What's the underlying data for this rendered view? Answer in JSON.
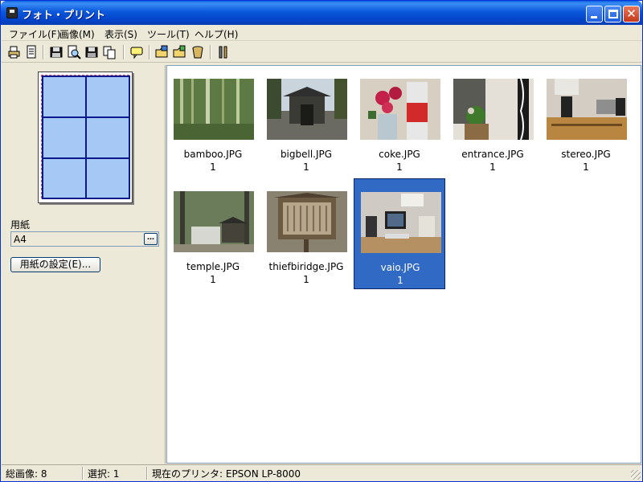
{
  "window": {
    "title": "フォト・プリント"
  },
  "menu": [
    {
      "label": "ファイル(F)"
    },
    {
      "label": "画像(M)"
    },
    {
      "label": "表示(S)"
    },
    {
      "label": "ツール(T)"
    },
    {
      "label": "ヘルプ(H)"
    }
  ],
  "toolbar_icons": [
    "print-icon",
    "preview-icon",
    "save-icon",
    "zoom-print-icon",
    "save-as-icon",
    "copy-icon",
    "comment-icon",
    "open-folder-icon",
    "add-folder-icon",
    "trash-icon",
    "settings-icon"
  ],
  "sidebar": {
    "paper_label": "用紙",
    "paper_value": "A4",
    "paper_browse": "…",
    "setup_button": "用紙の設定(E)..."
  },
  "thumbnails": [
    {
      "name": "bamboo.JPG",
      "count": "1",
      "selected": false
    },
    {
      "name": "bigbell.JPG",
      "count": "1",
      "selected": false
    },
    {
      "name": "coke.JPG",
      "count": "1",
      "selected": false
    },
    {
      "name": "entrance.JPG",
      "count": "1",
      "selected": false
    },
    {
      "name": "stereo.JPG",
      "count": "1",
      "selected": false
    },
    {
      "name": "temple.JPG",
      "count": "1",
      "selected": false
    },
    {
      "name": "thiefbiridge.JPG",
      "count": "1",
      "selected": false
    },
    {
      "name": "vaio.JPG",
      "count": "1",
      "selected": true
    }
  ],
  "status": {
    "total": "総画像: 8",
    "selected": "選択: 1",
    "printer": "現在のプリンタ: EPSON LP-8000"
  },
  "colors": {
    "selection": "#316ac5",
    "paper_cell": "#a6c8f5",
    "paper_grid": "#0b1a8a"
  }
}
